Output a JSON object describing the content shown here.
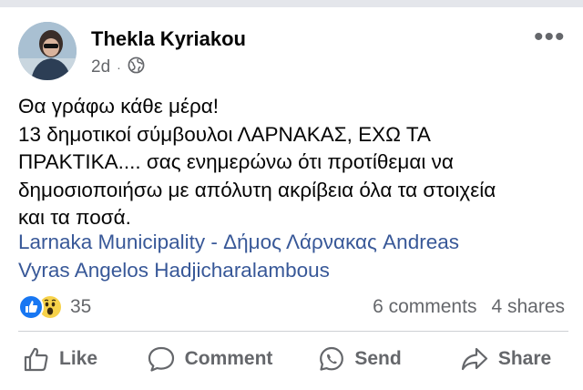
{
  "post": {
    "author": "Thekla Kyriakou",
    "timestamp": "2d",
    "separator": "·",
    "privacy_icon": "globe-icon",
    "more_label": "•••",
    "text_lines": [
      "Θα γράφω κάθε μέρα!",
      "13 δημοτικοί σύμβουλοι ΛΑΡΝΑΚΑΣ, ΕΧΩ ΤΑ",
      "ΠΡΑΚΤΙΚΑ.... σας ενημερώνω ότι προτίθεμαι να",
      "δημοσιοποιήσω με απόλυτη ακρίβεια όλα τα στοιχεία",
      "και τα ποσά."
    ],
    "tags": {
      "t1": "Larnaka Municipality - Δήμος Λάρνακας",
      "t2": "Andreas",
      "t3": "Vyras",
      "t4": "Angelos Hadjicharalambous"
    }
  },
  "reactions": {
    "icons": [
      "like-reaction-icon",
      "wow-reaction-icon"
    ],
    "count": "35",
    "comments": "6 comments",
    "shares": "4 shares"
  },
  "actions": {
    "like": "Like",
    "comment": "Comment",
    "send": "Send",
    "share": "Share"
  },
  "colors": {
    "link": "#385898",
    "secondary": "#65676b",
    "like_blue": "#1877f2",
    "wow_yellow": "#f7d24a"
  }
}
